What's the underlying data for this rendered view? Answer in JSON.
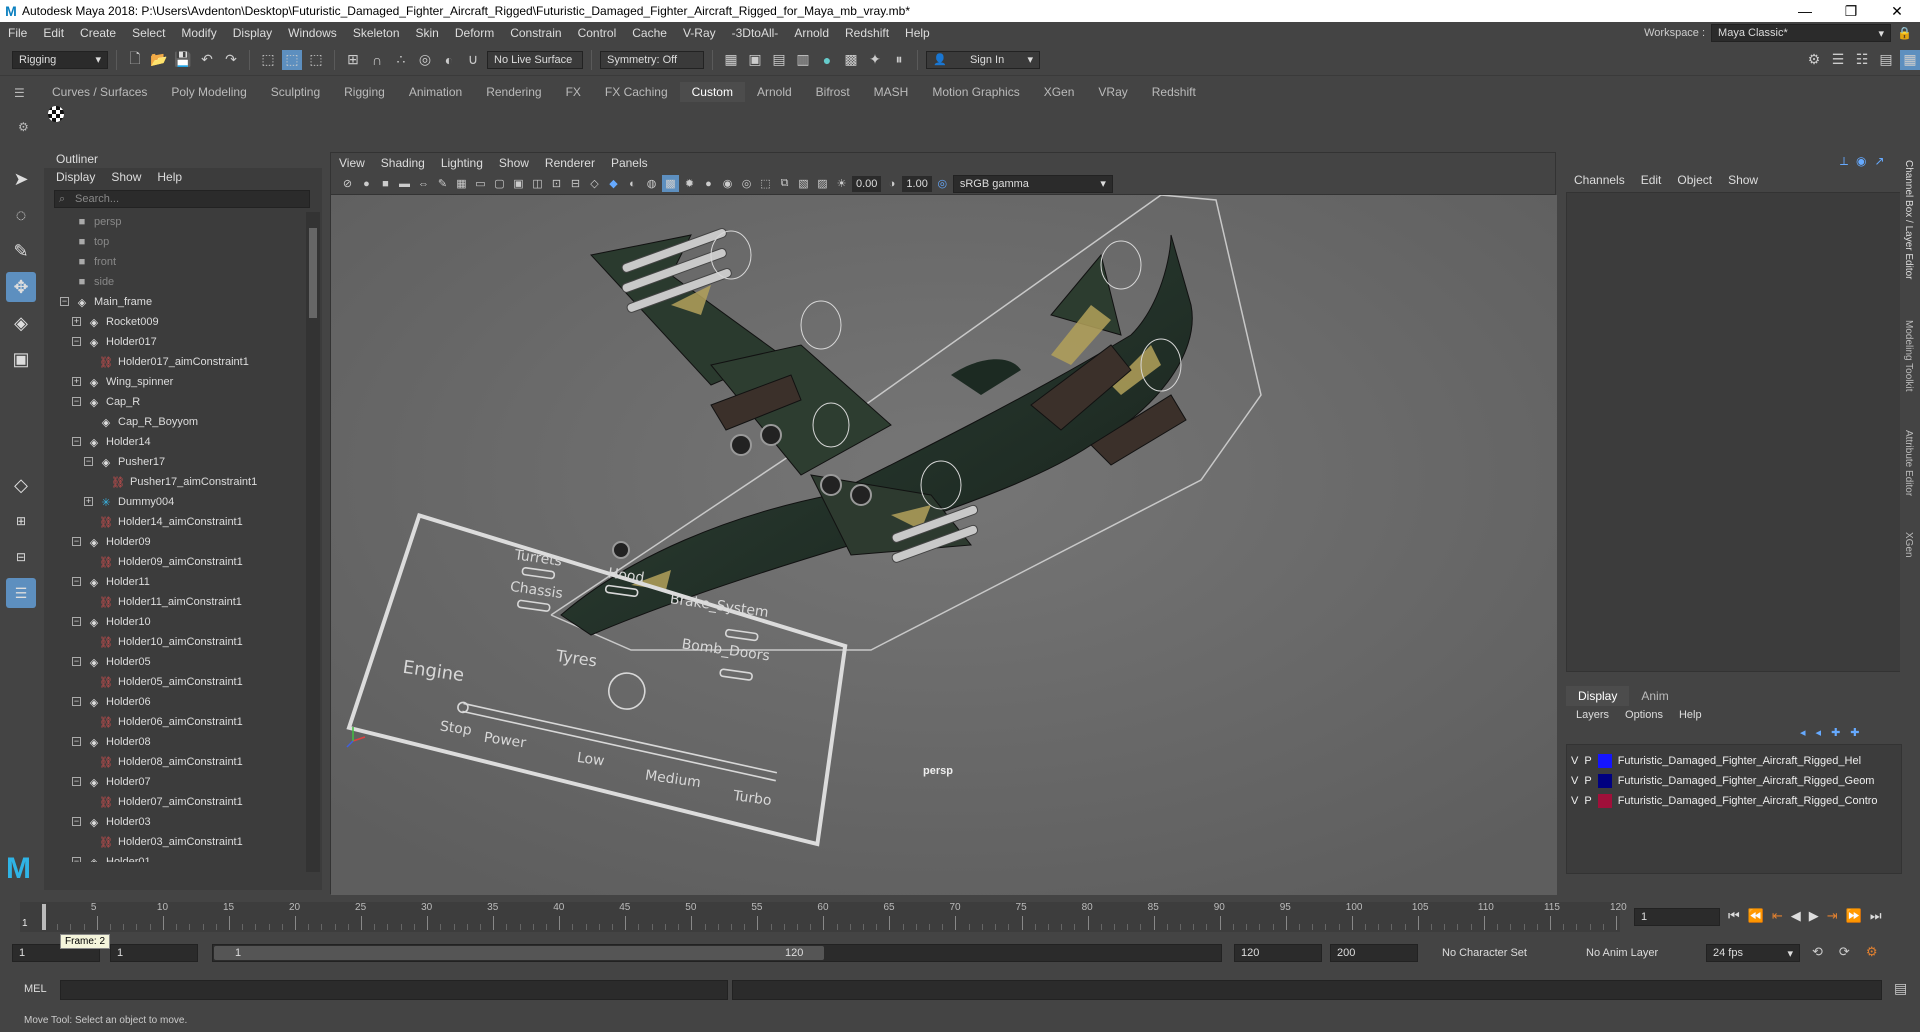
{
  "titlebar": {
    "title": "Autodesk Maya 2018: P:\\Users\\Avdenton\\Desktop\\Futuristic_Damaged_Fighter_Aircraft_Rigged\\Futuristic_Damaged_Fighter_Aircraft_Rigged_for_Maya_mb_vray.mb*"
  },
  "menubar": [
    "File",
    "Edit",
    "Create",
    "Select",
    "Modify",
    "Display",
    "Windows",
    "Skeleton",
    "Skin",
    "Deform",
    "Constrain",
    "Control",
    "Cache",
    "V-Ray",
    "-3DtoAll-",
    "Arnold",
    "Redshift",
    "Help"
  ],
  "workspace": {
    "label": "Workspace :",
    "value": "Maya Classic*"
  },
  "statusline": {
    "mode": "Rigging",
    "live_surface": "No Live Surface",
    "symmetry": "Symmetry: Off",
    "sign_in": "Sign In"
  },
  "shelf_tabs": [
    "Curves / Surfaces",
    "Poly Modeling",
    "Sculpting",
    "Rigging",
    "Animation",
    "Rendering",
    "FX",
    "FX Caching",
    "Custom",
    "Arnold",
    "Bifrost",
    "MASH",
    "Motion Graphics",
    "XGen",
    "VRay",
    "Redshift"
  ],
  "shelf_active": "Custom",
  "outliner": {
    "title": "Outliner",
    "menu": [
      "Display",
      "Show",
      "Help"
    ],
    "search_placeholder": "Search...",
    "items": [
      {
        "label": "persp",
        "type": "camera",
        "depth": 0
      },
      {
        "label": "top",
        "type": "camera",
        "depth": 0
      },
      {
        "label": "front",
        "type": "camera",
        "depth": 0
      },
      {
        "label": "side",
        "type": "camera",
        "depth": 0
      },
      {
        "label": "Main_frame",
        "type": "transform",
        "depth": 0,
        "expander": "minus"
      },
      {
        "label": "Rocket009",
        "type": "transform",
        "depth": 1,
        "expander": "plus"
      },
      {
        "label": "Holder017",
        "type": "transform",
        "depth": 1,
        "expander": "minus"
      },
      {
        "label": "Holder017_aimConstraint1",
        "type": "constraint",
        "depth": 2
      },
      {
        "label": "Wing_spinner",
        "type": "transform",
        "depth": 1,
        "expander": "plus"
      },
      {
        "label": "Cap_R",
        "type": "transform",
        "depth": 1,
        "expander": "minus"
      },
      {
        "label": "Cap_R_Boyyom",
        "type": "transform",
        "depth": 2
      },
      {
        "label": "Holder14",
        "type": "transform",
        "depth": 1,
        "expander": "minus"
      },
      {
        "label": "Pusher17",
        "type": "transform",
        "depth": 2,
        "expander": "minus"
      },
      {
        "label": "Pusher17_aimConstraint1",
        "type": "constraint",
        "depth": 3
      },
      {
        "label": "Dummy004",
        "type": "dummy",
        "depth": 2,
        "expander": "plus"
      },
      {
        "label": "Holder14_aimConstraint1",
        "type": "constraint",
        "depth": 2
      },
      {
        "label": "Holder09",
        "type": "transform",
        "depth": 1,
        "expander": "minus"
      },
      {
        "label": "Holder09_aimConstraint1",
        "type": "constraint",
        "depth": 2
      },
      {
        "label": "Holder11",
        "type": "transform",
        "depth": 1,
        "expander": "minus"
      },
      {
        "label": "Holder11_aimConstraint1",
        "type": "constraint",
        "depth": 2
      },
      {
        "label": "Holder10",
        "type": "transform",
        "depth": 1,
        "expander": "minus"
      },
      {
        "label": "Holder10_aimConstraint1",
        "type": "constraint",
        "depth": 2
      },
      {
        "label": "Holder05",
        "type": "transform",
        "depth": 1,
        "expander": "minus"
      },
      {
        "label": "Holder05_aimConstraint1",
        "type": "constraint",
        "depth": 2
      },
      {
        "label": "Holder06",
        "type": "transform",
        "depth": 1,
        "expander": "minus"
      },
      {
        "label": "Holder06_aimConstraint1",
        "type": "constraint",
        "depth": 2
      },
      {
        "label": "Holder08",
        "type": "transform",
        "depth": 1,
        "expander": "minus"
      },
      {
        "label": "Holder08_aimConstraint1",
        "type": "constraint",
        "depth": 2
      },
      {
        "label": "Holder07",
        "type": "transform",
        "depth": 1,
        "expander": "minus"
      },
      {
        "label": "Holder07_aimConstraint1",
        "type": "constraint",
        "depth": 2
      },
      {
        "label": "Holder03",
        "type": "transform",
        "depth": 1,
        "expander": "minus"
      },
      {
        "label": "Holder03_aimConstraint1",
        "type": "constraint",
        "depth": 2
      },
      {
        "label": "Holder01",
        "type": "transform",
        "depth": 1,
        "expander": "minus"
      }
    ]
  },
  "viewport": {
    "menu": [
      "View",
      "Shading",
      "Lighting",
      "Show",
      "Renderer",
      "Panels"
    ],
    "near_value": "0.00",
    "far_value": "1.00",
    "color_space": "sRGB gamma",
    "camera_label": "persp",
    "control_board": {
      "labels": [
        "Turrets",
        "Hood",
        "Brake_System",
        "Chassis",
        "Bomb_Doors",
        "Tyres",
        "Engine",
        "Stop",
        "Power",
        "Low",
        "Medium",
        "Turbo"
      ]
    }
  },
  "channelbox": {
    "menu": [
      "Channels",
      "Edit",
      "Object",
      "Show"
    ],
    "side_tabs": [
      "Channel Box / Layer Editor",
      "Modeling Toolkit",
      "Attribute Editor",
      "XGen"
    ]
  },
  "layer_editor": {
    "tabs": [
      "Display",
      "Anim"
    ],
    "active_tab": "Display",
    "menu": [
      "Layers",
      "Options",
      "Help"
    ],
    "layers": [
      {
        "v": "V",
        "p": "P",
        "name": "Futuristic_Damaged_Fighter_Aircraft_Rigged_Hel",
        "color": "#1515ff"
      },
      {
        "v": "V",
        "p": "P",
        "name": "Futuristic_Damaged_Fighter_Aircraft_Rigged_Geom",
        "color": "#000080"
      },
      {
        "v": "V",
        "p": "P",
        "name": "Futuristic_Damaged_Fighter_Aircraft_Rigged_Contro",
        "color": "#a0103a"
      }
    ]
  },
  "timeline": {
    "tick_labels": [
      "5",
      "10",
      "15",
      "20",
      "25",
      "30",
      "35",
      "40",
      "45",
      "50",
      "55",
      "60",
      "65",
      "70",
      "75",
      "80",
      "85",
      "90",
      "95",
      "100",
      "105",
      "110",
      "115",
      "120"
    ],
    "current_frame": "1",
    "current_frame_marker": "1",
    "frame_tooltip": "Frame: 2"
  },
  "range": {
    "start": "1",
    "inner_start": "1",
    "slider_start": "1",
    "slider_end": "120",
    "end": "120",
    "max": "200",
    "character_set": "No Character Set",
    "anim_layer": "No Anim Layer",
    "fps": "24 fps"
  },
  "cmdline": {
    "label": "MEL"
  },
  "helpline": {
    "text": "Move Tool: Select an object to move."
  }
}
